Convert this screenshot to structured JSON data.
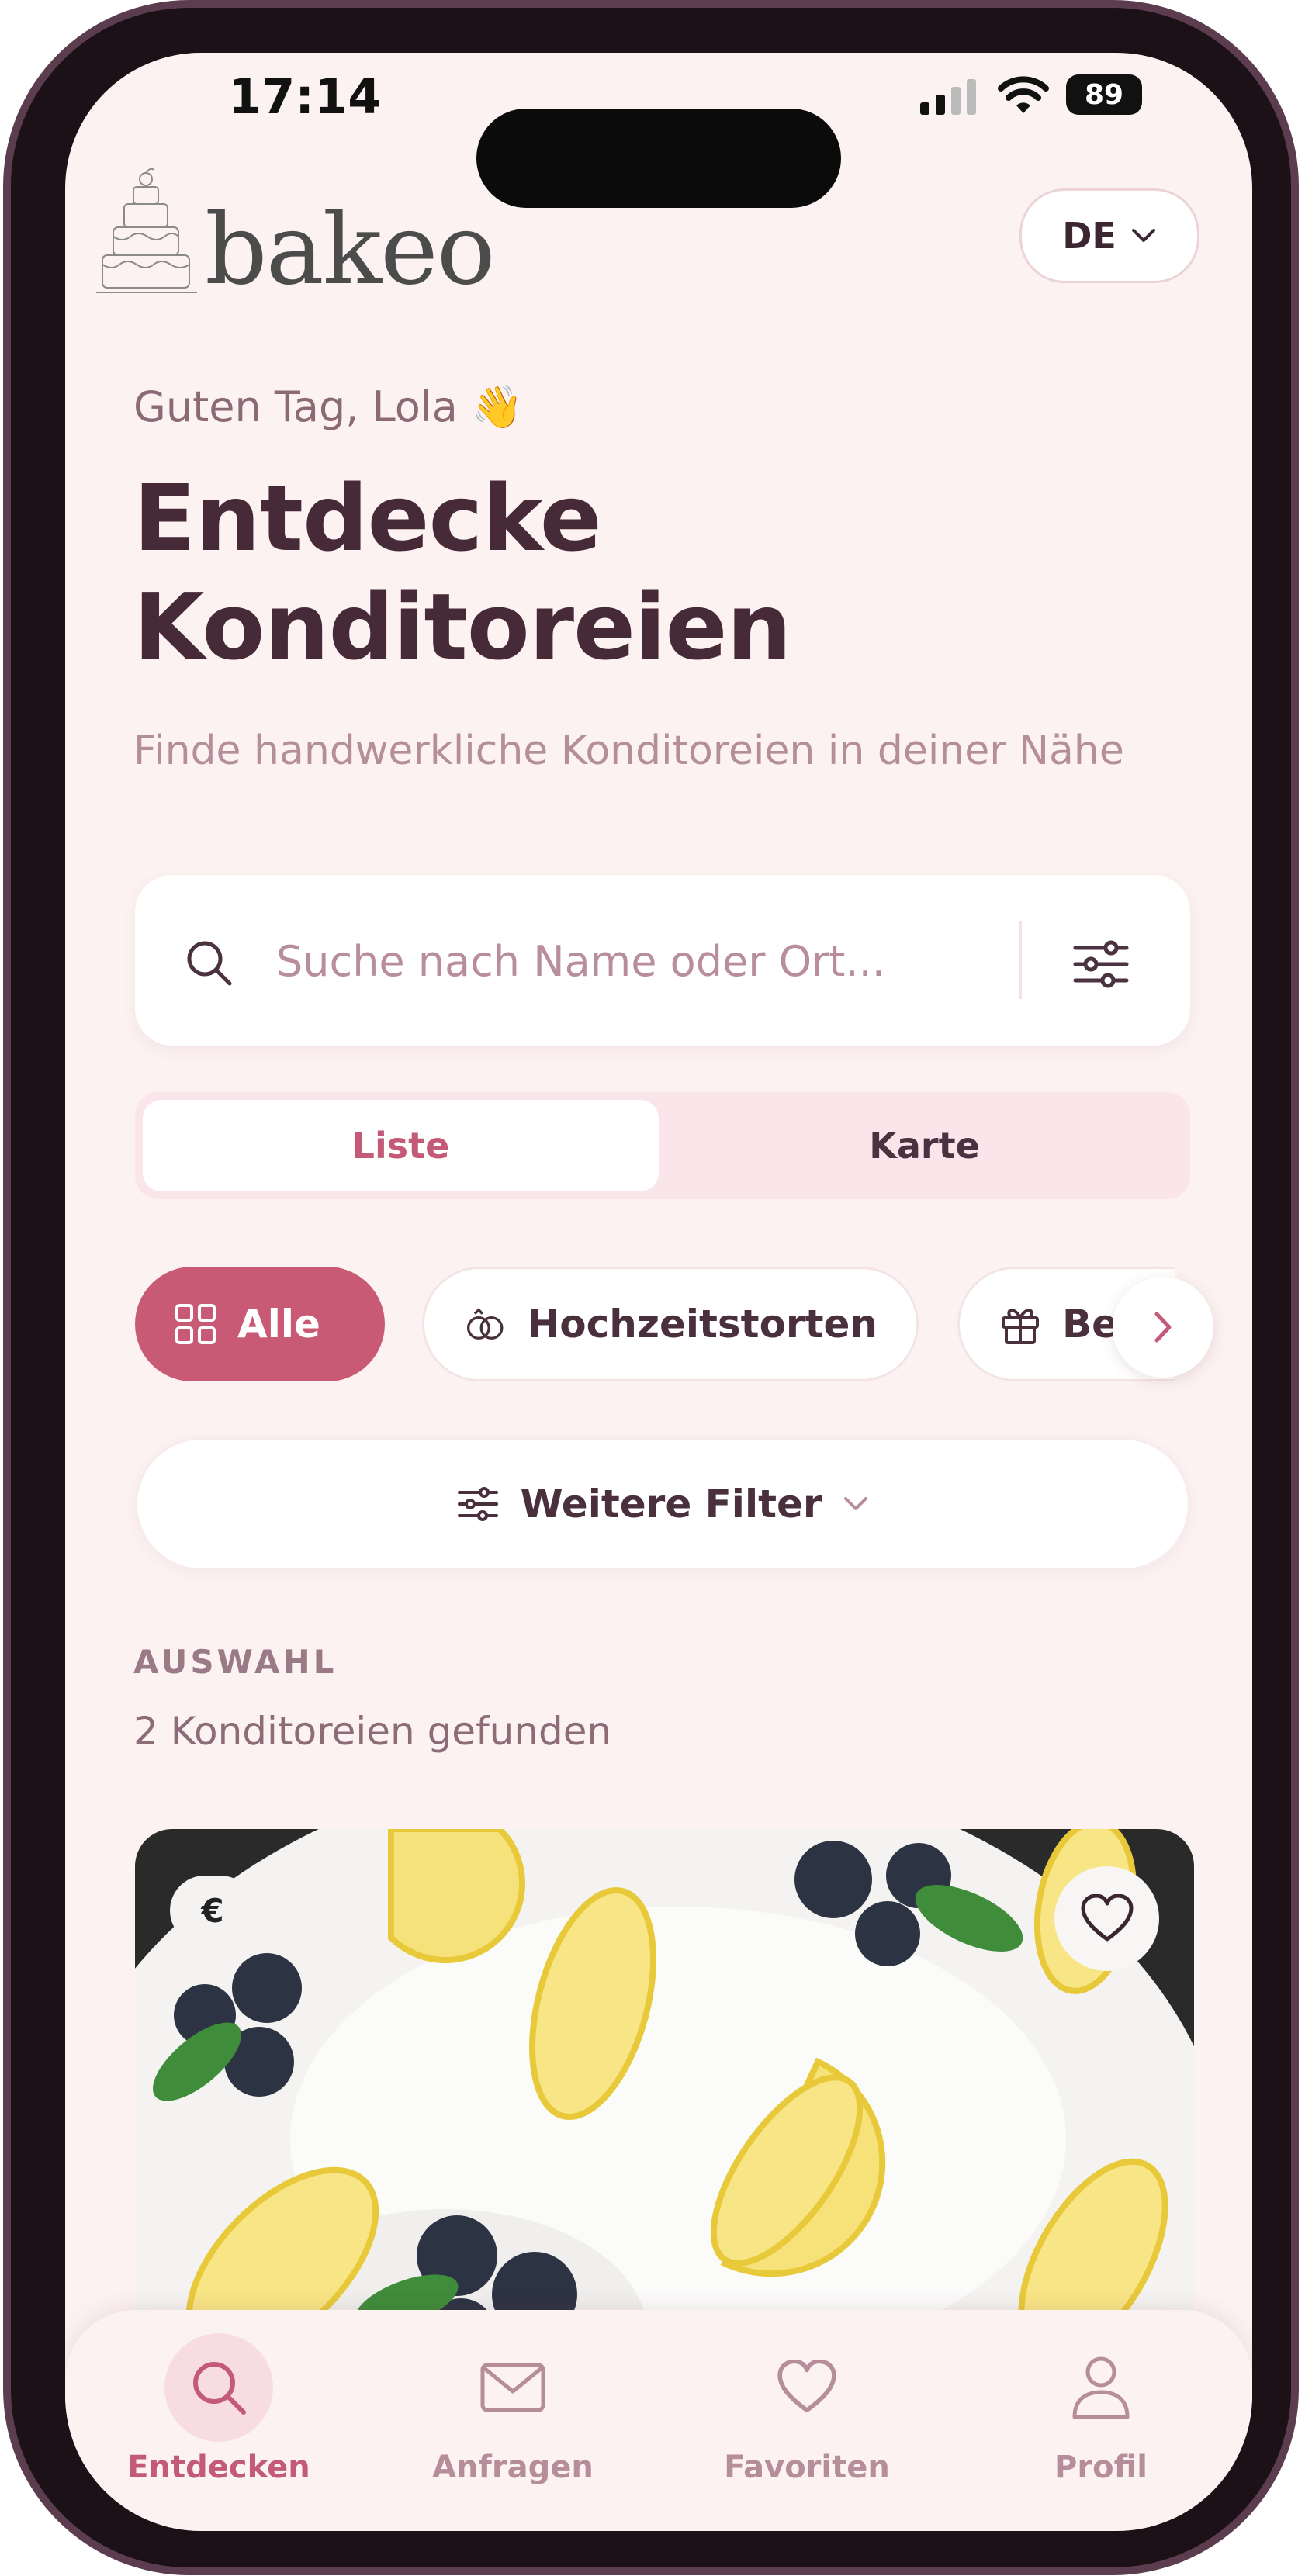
{
  "status_bar": {
    "time": "17:14",
    "battery": "89"
  },
  "brand": {
    "logo_text": "bakeo"
  },
  "language": {
    "current": "DE"
  },
  "hero": {
    "greeting": "Guten Tag, Lola",
    "greeting_emoji": "👋",
    "title_line1": "Entdecke",
    "title_line2": "Konditoreien",
    "subtitle": "Finde handwerkliche Konditoreien in deiner Nähe"
  },
  "search": {
    "placeholder": "Suche nach Name oder Ort..."
  },
  "view_toggle": {
    "list_label": "Liste",
    "map_label": "Karte",
    "selected": "Liste"
  },
  "categories": [
    {
      "label": "Alle",
      "icon": "grid-icon",
      "selected": true
    },
    {
      "label": "Hochzeitstorten",
      "icon": "rings-icon",
      "selected": false
    },
    {
      "label": "Be",
      "icon": "gift-icon",
      "selected": false
    }
  ],
  "more_filters": {
    "label": "Weitere Filter"
  },
  "results": {
    "section_label": "AUSWAHL",
    "count_text": "2 Konditoreien gefunden"
  },
  "card": {
    "price_badge": "€",
    "image": "lemon-blueberry-cake"
  },
  "bottom_nav": [
    {
      "label": "Entdecken",
      "icon": "search-icon",
      "active": true
    },
    {
      "label": "Anfragen",
      "icon": "mail-icon",
      "active": false
    },
    {
      "label": "Favoriten",
      "icon": "heart-icon",
      "active": false
    },
    {
      "label": "Profil",
      "icon": "user-icon",
      "active": false
    }
  ],
  "colors": {
    "accent": "#c85a76",
    "heading": "#472a38",
    "background": "#fcf2f1"
  }
}
